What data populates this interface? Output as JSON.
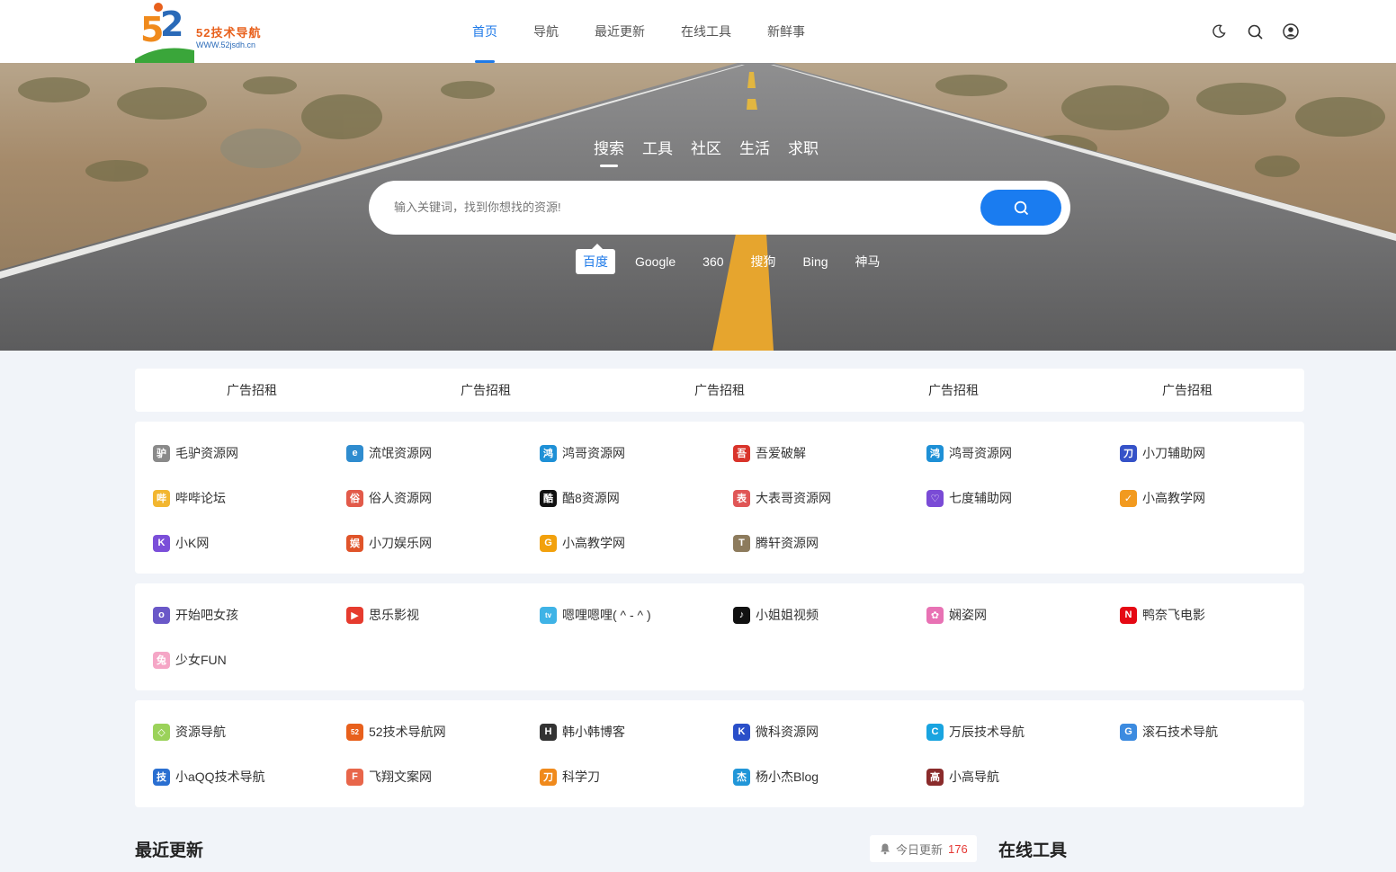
{
  "header": {
    "logo_text": "52技术导航",
    "logo_sub": "WWW.52jsdh.cn",
    "nav": [
      {
        "label": "首页",
        "active": true
      },
      {
        "label": "导航",
        "active": false
      },
      {
        "label": "最近更新",
        "active": false
      },
      {
        "label": "在线工具",
        "active": false
      },
      {
        "label": "新鲜事",
        "active": false
      }
    ],
    "icons": [
      "moon-icon",
      "search-icon",
      "user-icon"
    ]
  },
  "hero": {
    "tabs": [
      {
        "label": "搜索",
        "active": true
      },
      {
        "label": "工具",
        "active": false
      },
      {
        "label": "社区",
        "active": false
      },
      {
        "label": "生活",
        "active": false
      },
      {
        "label": "求职",
        "active": false
      }
    ],
    "search_placeholder": "输入关键词，找到你想找的资源!",
    "search_value": "",
    "engines": [
      {
        "label": "百度",
        "active": true
      },
      {
        "label": "Google",
        "active": false
      },
      {
        "label": "360",
        "active": false
      },
      {
        "label": "搜狗",
        "active": false
      },
      {
        "label": "Bing",
        "active": false
      },
      {
        "label": "神马",
        "active": false
      }
    ]
  },
  "ads": [
    "广告招租",
    "广告招租",
    "广告招租",
    "广告招租",
    "广告招租"
  ],
  "card1": [
    {
      "name": "毛驴资源网",
      "icon": "donkey-icon",
      "color": "#8a8a8a",
      "glyph": "驴"
    },
    {
      "name": "流氓资源网",
      "icon": "globe-icon",
      "color": "#2f8ccf",
      "glyph": "e"
    },
    {
      "name": "鸿哥资源网",
      "icon": "bird-icon",
      "color": "#1e90d6",
      "glyph": "鸿"
    },
    {
      "name": "吾爱破解",
      "icon": "wuai-icon",
      "color": "#d9342b",
      "glyph": "吾"
    },
    {
      "name": "鸿哥资源网",
      "icon": "bird-icon",
      "color": "#1e90d6",
      "glyph": "鸿"
    },
    {
      "name": "小刀辅助网",
      "icon": "knife-icon",
      "color": "#3552c8",
      "glyph": "刀"
    },
    {
      "name": "哔哔论坛",
      "icon": "folder-icon",
      "color": "#f2b630",
      "glyph": "哔"
    },
    {
      "name": "俗人资源网",
      "icon": "suren-icon",
      "color": "#e25a4a",
      "glyph": "俗"
    },
    {
      "name": "酷8资源网",
      "icon": "ku8-icon",
      "color": "#111111",
      "glyph": "酷"
    },
    {
      "name": "大表哥资源网",
      "icon": "dabiaoge-icon",
      "color": "#e05656",
      "glyph": "表"
    },
    {
      "name": "七度辅助网",
      "icon": "heart-icon",
      "color": "#7a4bd6",
      "glyph": "♡"
    },
    {
      "name": "小高教学网",
      "icon": "badge-icon",
      "color": "#f29a1f",
      "glyph": "✓"
    },
    {
      "name": "小K网",
      "icon": "k-icon",
      "color": "#7b4fd9",
      "glyph": "K"
    },
    {
      "name": "小刀娱乐网",
      "icon": "xiaodao-icon",
      "color": "#e0542a",
      "glyph": "娱"
    },
    {
      "name": "小高教学网",
      "icon": "g-icon",
      "color": "#f2a10d",
      "glyph": "G"
    },
    {
      "name": "腾轩资源网",
      "icon": "tengxuan-icon",
      "color": "#8d7b5d",
      "glyph": "T"
    }
  ],
  "card2": [
    {
      "name": "开始吧女孩",
      "icon": "girl-icon",
      "color": "#6a58c8",
      "glyph": "o"
    },
    {
      "name": "思乐影视",
      "icon": "play-icon",
      "color": "#e63b2e",
      "glyph": "▶"
    },
    {
      "name": "嗯哩嗯哩( ^ - ^ )",
      "icon": "tv-icon",
      "color": "#3fb3e6",
      "glyph": "tv"
    },
    {
      "name": "小姐姐视频",
      "icon": "tiktok-icon",
      "color": "#111111",
      "glyph": "♪"
    },
    {
      "name": "娴姿网",
      "icon": "flower-icon",
      "color": "#e872b4",
      "glyph": "✿"
    },
    {
      "name": "鸭奈飞电影",
      "icon": "netflix-icon",
      "color": "#e50914",
      "glyph": "N"
    },
    {
      "name": "少女FUN",
      "icon": "bunny-icon",
      "color": "#f5a6c6",
      "glyph": "兔"
    }
  ],
  "card3": [
    {
      "name": "资源导航",
      "icon": "diamond-icon",
      "color": "#9bd25a",
      "glyph": "◇"
    },
    {
      "name": "52技术导航网",
      "icon": "fiftytwo-icon",
      "color": "#e8601c",
      "glyph": "52"
    },
    {
      "name": "韩小韩博客",
      "icon": "h-icon",
      "color": "#333333",
      "glyph": "H"
    },
    {
      "name": "微科资源网",
      "icon": "weike-icon",
      "color": "#2a4fc9",
      "glyph": "K"
    },
    {
      "name": "万辰技术导航",
      "icon": "ring-icon",
      "color": "#19a4e0",
      "glyph": "C"
    },
    {
      "name": "滚石技术导航",
      "icon": "gunshi-icon",
      "color": "#3c8be0",
      "glyph": "G"
    },
    {
      "name": "小aQQ技术导航",
      "icon": "ji-icon",
      "color": "#2a6fd1",
      "glyph": "技"
    },
    {
      "name": "飞翔文案网",
      "icon": "feixiang-icon",
      "color": "#e8664a",
      "glyph": "F"
    },
    {
      "name": "科学刀",
      "icon": "kexuedao-icon",
      "color": "#f08a1c",
      "glyph": "刀"
    },
    {
      "name": "杨小杰Blog",
      "icon": "yang-icon",
      "color": "#2196d8",
      "glyph": "杰"
    },
    {
      "name": "小高导航",
      "icon": "avatar-icon",
      "color": "#8a2b2b",
      "glyph": "高"
    }
  ],
  "bottom": {
    "recent_title": "最近更新",
    "today_label": "今日更新",
    "today_count": "176",
    "tools_title": "在线工具"
  }
}
